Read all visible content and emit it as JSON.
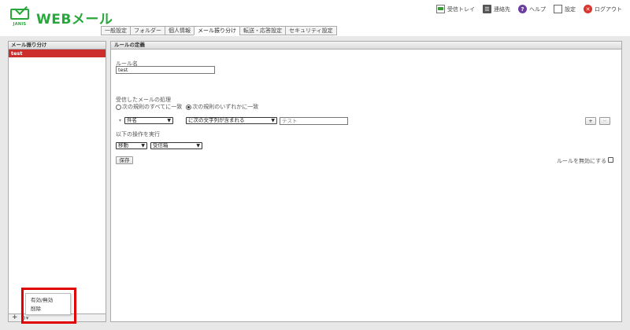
{
  "app": {
    "logo_small": "JANIS",
    "title": "WEBメール"
  },
  "toolbar": {
    "inbox": "受信トレイ",
    "contacts": "連絡先",
    "help": "ヘルプ",
    "settings": "設定",
    "logout": "ログアウト"
  },
  "tabs": [
    {
      "label": "一般設定"
    },
    {
      "label": "フォルダー"
    },
    {
      "label": "個人情報"
    },
    {
      "label": "メール振り分け",
      "active": true
    },
    {
      "label": "転送・応答設定"
    },
    {
      "label": "セキュリティ設定"
    }
  ],
  "sidebar": {
    "heading": "メール振り分け",
    "items": [
      {
        "label": "test",
        "selected": true
      }
    ],
    "add_label": "+",
    "gear_label": "⚙▾"
  },
  "context_menu": {
    "items": [
      {
        "label": "有効/無効"
      },
      {
        "label": "削除"
      }
    ]
  },
  "main": {
    "heading": "ルールの定義",
    "rule_name_label": "ルール名",
    "rule_name_value": "test",
    "incoming_label": "受信したメールの処理",
    "radio_all": "次の規則のすべてに一致",
    "radio_any": "次の規則のいずれかに一致",
    "selected_radio": "any",
    "condition": {
      "field": "件名",
      "operator": "に次の文字列が含まれる",
      "value_placeholder": "テスト"
    },
    "action_label": "以下の操作を実行",
    "action": {
      "operation": "移動",
      "target": "受信箱"
    },
    "save_label": "保存",
    "disable_label": "ルールを無効にする",
    "disable_checked": false,
    "add_btn": "+",
    "remove_btn": "−"
  }
}
